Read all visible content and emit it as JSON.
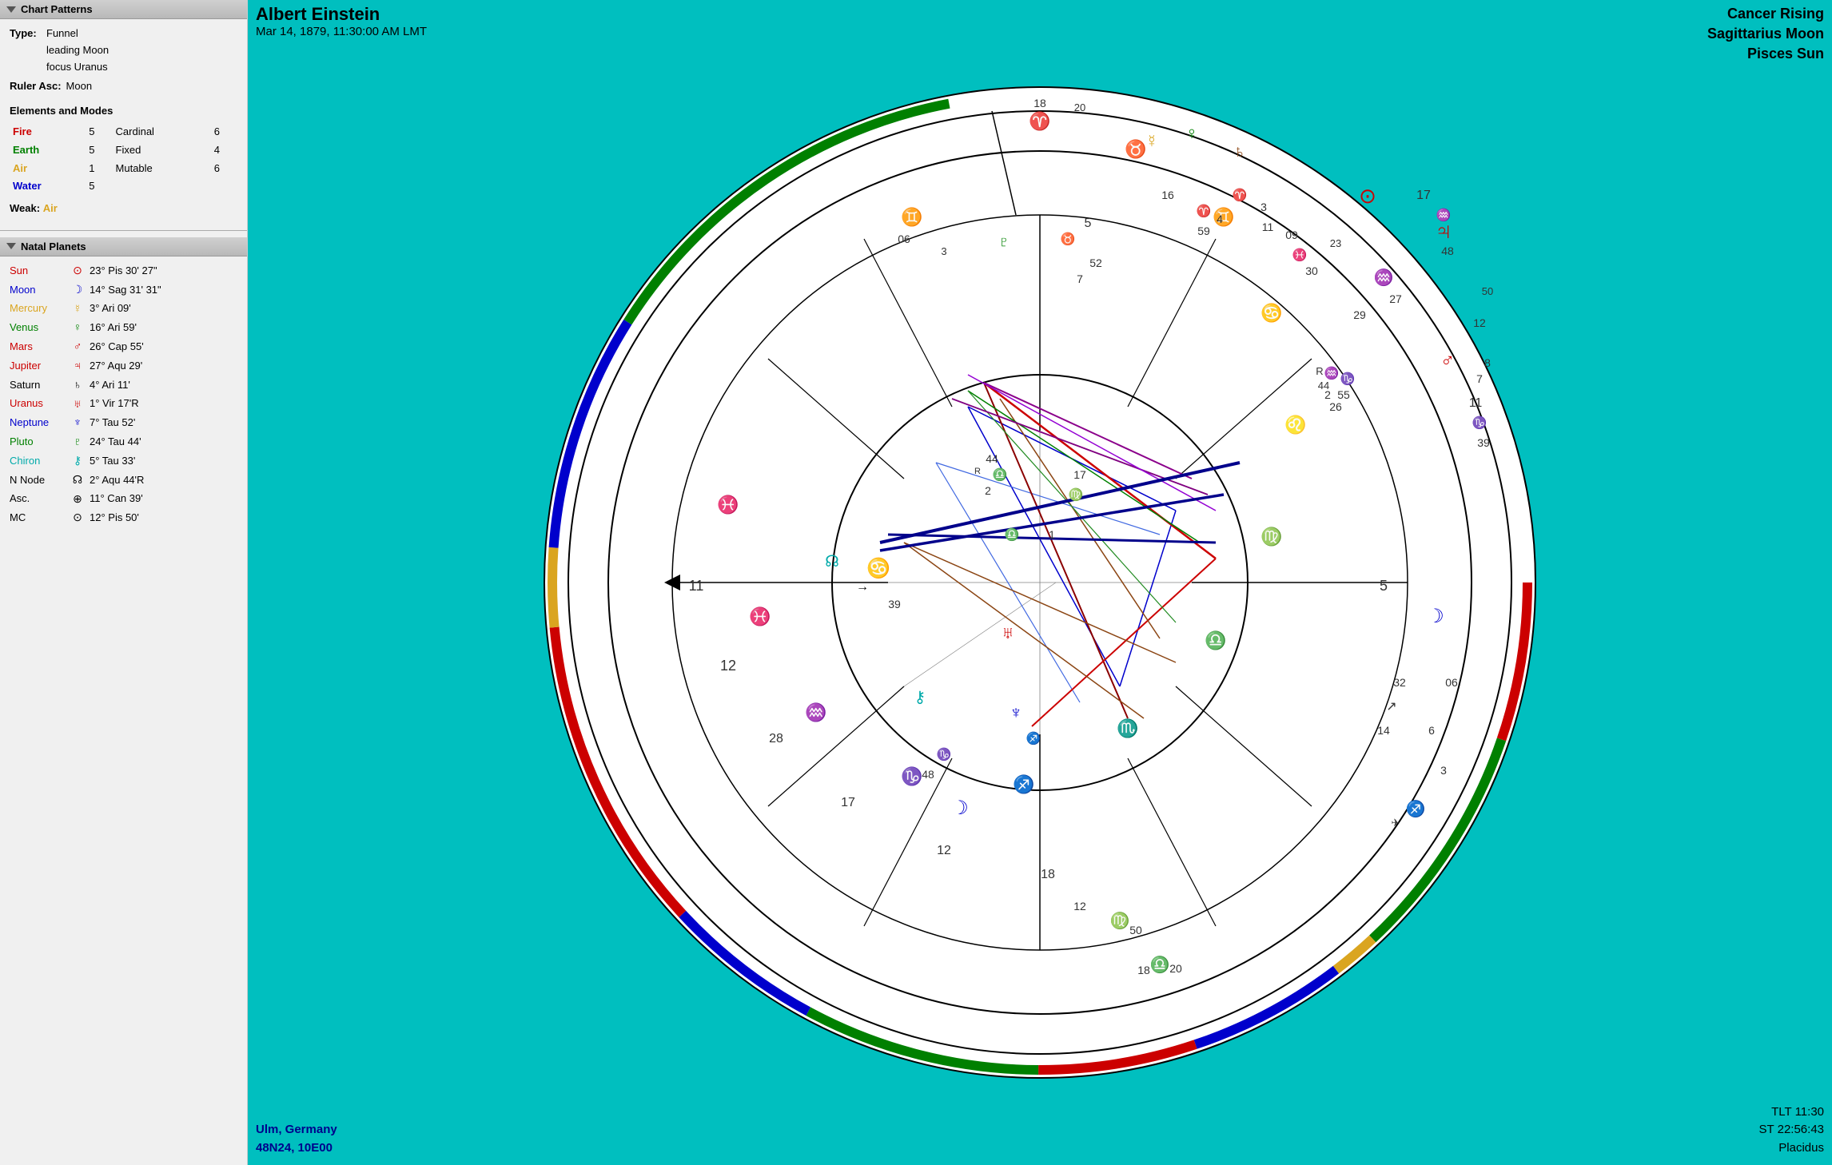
{
  "leftPanel": {
    "chartPatterns": {
      "header": "Chart Patterns",
      "typeLabel": "Type:",
      "typeValues": [
        "Funnel",
        "leading Moon",
        "focus Uranus"
      ],
      "rulerLabel": "Ruler Asc:",
      "rulerValue": "Moon",
      "elementsHeader": "Elements and Modes",
      "elements": [
        {
          "name": "Fire",
          "count": "5",
          "mode": "Cardinal",
          "modeCount": "6",
          "color": "fire"
        },
        {
          "name": "Earth",
          "count": "5",
          "mode": "Fixed",
          "modeCount": "4",
          "color": "earth"
        },
        {
          "name": "Air",
          "count": "1",
          "mode": "Mutable",
          "modeCount": "6",
          "color": "air"
        },
        {
          "name": "Water",
          "count": "5",
          "mode": "",
          "modeCount": "",
          "color": "water"
        }
      ],
      "weakLabel": "Weak:",
      "weakValue": "Air"
    },
    "natalPlanets": {
      "header": "Natal Planets",
      "planets": [
        {
          "name": "Sun",
          "symbol": "⊙",
          "degree": "23° Pis 30' 27\"",
          "color": "sun"
        },
        {
          "name": "Moon",
          "symbol": "☽",
          "degree": "14° Sag 31' 31\"",
          "color": "moon"
        },
        {
          "name": "Mercury",
          "symbol": "☿",
          "degree": "3° Ari 09'",
          "color": "mercury"
        },
        {
          "name": "Venus",
          "symbol": "♀",
          "degree": "16° Ari 59'",
          "color": "venus"
        },
        {
          "name": "Mars",
          "symbol": "♂",
          "degree": "26° Cap 55'",
          "color": "mars"
        },
        {
          "name": "Jupiter",
          "symbol": "♃",
          "degree": "27° Aqu 29'",
          "color": "jupiter"
        },
        {
          "name": "Saturn",
          "symbol": "♄",
          "degree": "4° Ari 11'",
          "color": "saturn"
        },
        {
          "name": "Uranus",
          "symbol": "♅",
          "degree": "1° Vir 17'R",
          "color": "uranus"
        },
        {
          "name": "Neptune",
          "symbol": "♆",
          "degree": "7° Tau 52'",
          "color": "neptune"
        },
        {
          "name": "Pluto",
          "symbol": "♀",
          "degree": "24° Tau 44'",
          "color": "pluto"
        },
        {
          "name": "Chiron",
          "symbol": "⚷",
          "degree": "5° Tau 33'",
          "color": "chiron"
        },
        {
          "name": "N Node",
          "symbol": "☊",
          "degree": "2° Aqu 44'R",
          "color": "nnode"
        },
        {
          "name": "Asc.",
          "symbol": "⊕",
          "degree": "11° Can 39'",
          "color": "asc"
        },
        {
          "name": "MC",
          "symbol": "⊙",
          "degree": "12° Pis 50'",
          "color": "mc"
        }
      ]
    }
  },
  "chart": {
    "title": "Albert Einstein",
    "date": "Mar 14, 1879, 11:30:00 AM LMT",
    "topRight": {
      "line1": "Cancer Rising",
      "line2": "Sagittarius Moon",
      "line3": "Pisces Sun"
    },
    "bottomLeft": {
      "line1": "Ulm, Germany",
      "line2": "48N24, 10E00"
    },
    "bottomRight": {
      "line1": "TLT 11:30",
      "line2": "ST 22:56:43",
      "line3": "Placidus"
    }
  }
}
